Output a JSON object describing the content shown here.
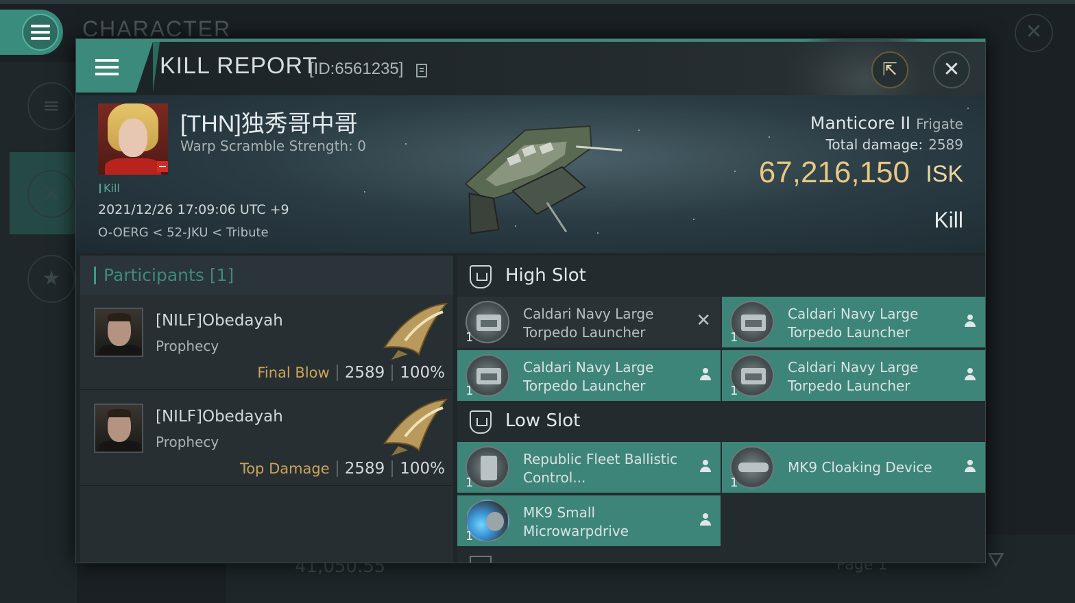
{
  "background": {
    "title": "CHARACTER",
    "bottom_value": "41,050.55",
    "page_label": "Page 1"
  },
  "header": {
    "title": "KILL REPORT",
    "id": "[ID:6561235]"
  },
  "victim": {
    "name": "[THN]独秀哥中哥",
    "warp_scramble": "Warp Scramble Strength: 0",
    "tag": "Kill",
    "timestamp": "2021/12/26 17:09:06 UTC +9",
    "location": "O-OERG < 52-JKU < Tribute"
  },
  "ship": {
    "name": "Manticore II",
    "class": "Frigate",
    "total_damage_label": "Total damage:",
    "total_damage": "2589",
    "isk_value": "67,216,150",
    "isk_unit": "ISK",
    "result": "Kill"
  },
  "participants": {
    "header": "Participants [1]",
    "rows": [
      {
        "name": "[NILF]Obedayah",
        "ship": "Prophecy",
        "label": "Final Blow",
        "damage": "2589",
        "percent": "100%"
      },
      {
        "name": "[NILF]Obedayah",
        "ship": "Prophecy",
        "label": "Top Damage",
        "damage": "2589",
        "percent": "100%"
      }
    ]
  },
  "fitting": {
    "high_slot": {
      "label": "High Slot",
      "modules": [
        {
          "name": "Caldari Navy Large Torpedo Launcher",
          "qty": "1",
          "state": "destroyed"
        },
        {
          "name": "Caldari Navy Large Torpedo Launcher",
          "qty": "1",
          "state": "dropped"
        },
        {
          "name": "Caldari Navy Large Torpedo Launcher",
          "qty": "1",
          "state": "dropped"
        },
        {
          "name": "Caldari Navy Large Torpedo Launcher",
          "qty": "1",
          "state": "dropped"
        }
      ]
    },
    "low_slot": {
      "label": "Low Slot",
      "modules": [
        {
          "name": "Republic Fleet Ballistic Control...",
          "qty": "1",
          "state": "dropped"
        },
        {
          "name": "MK9 Cloaking Device",
          "qty": "1",
          "state": "dropped"
        },
        {
          "name": "MK9 Small Microwarpdrive",
          "qty": "1",
          "state": "dropped"
        }
      ]
    }
  },
  "colors": {
    "accent": "#3e8579",
    "isk": "#e8c882",
    "final_blow": "#c9a55a"
  }
}
